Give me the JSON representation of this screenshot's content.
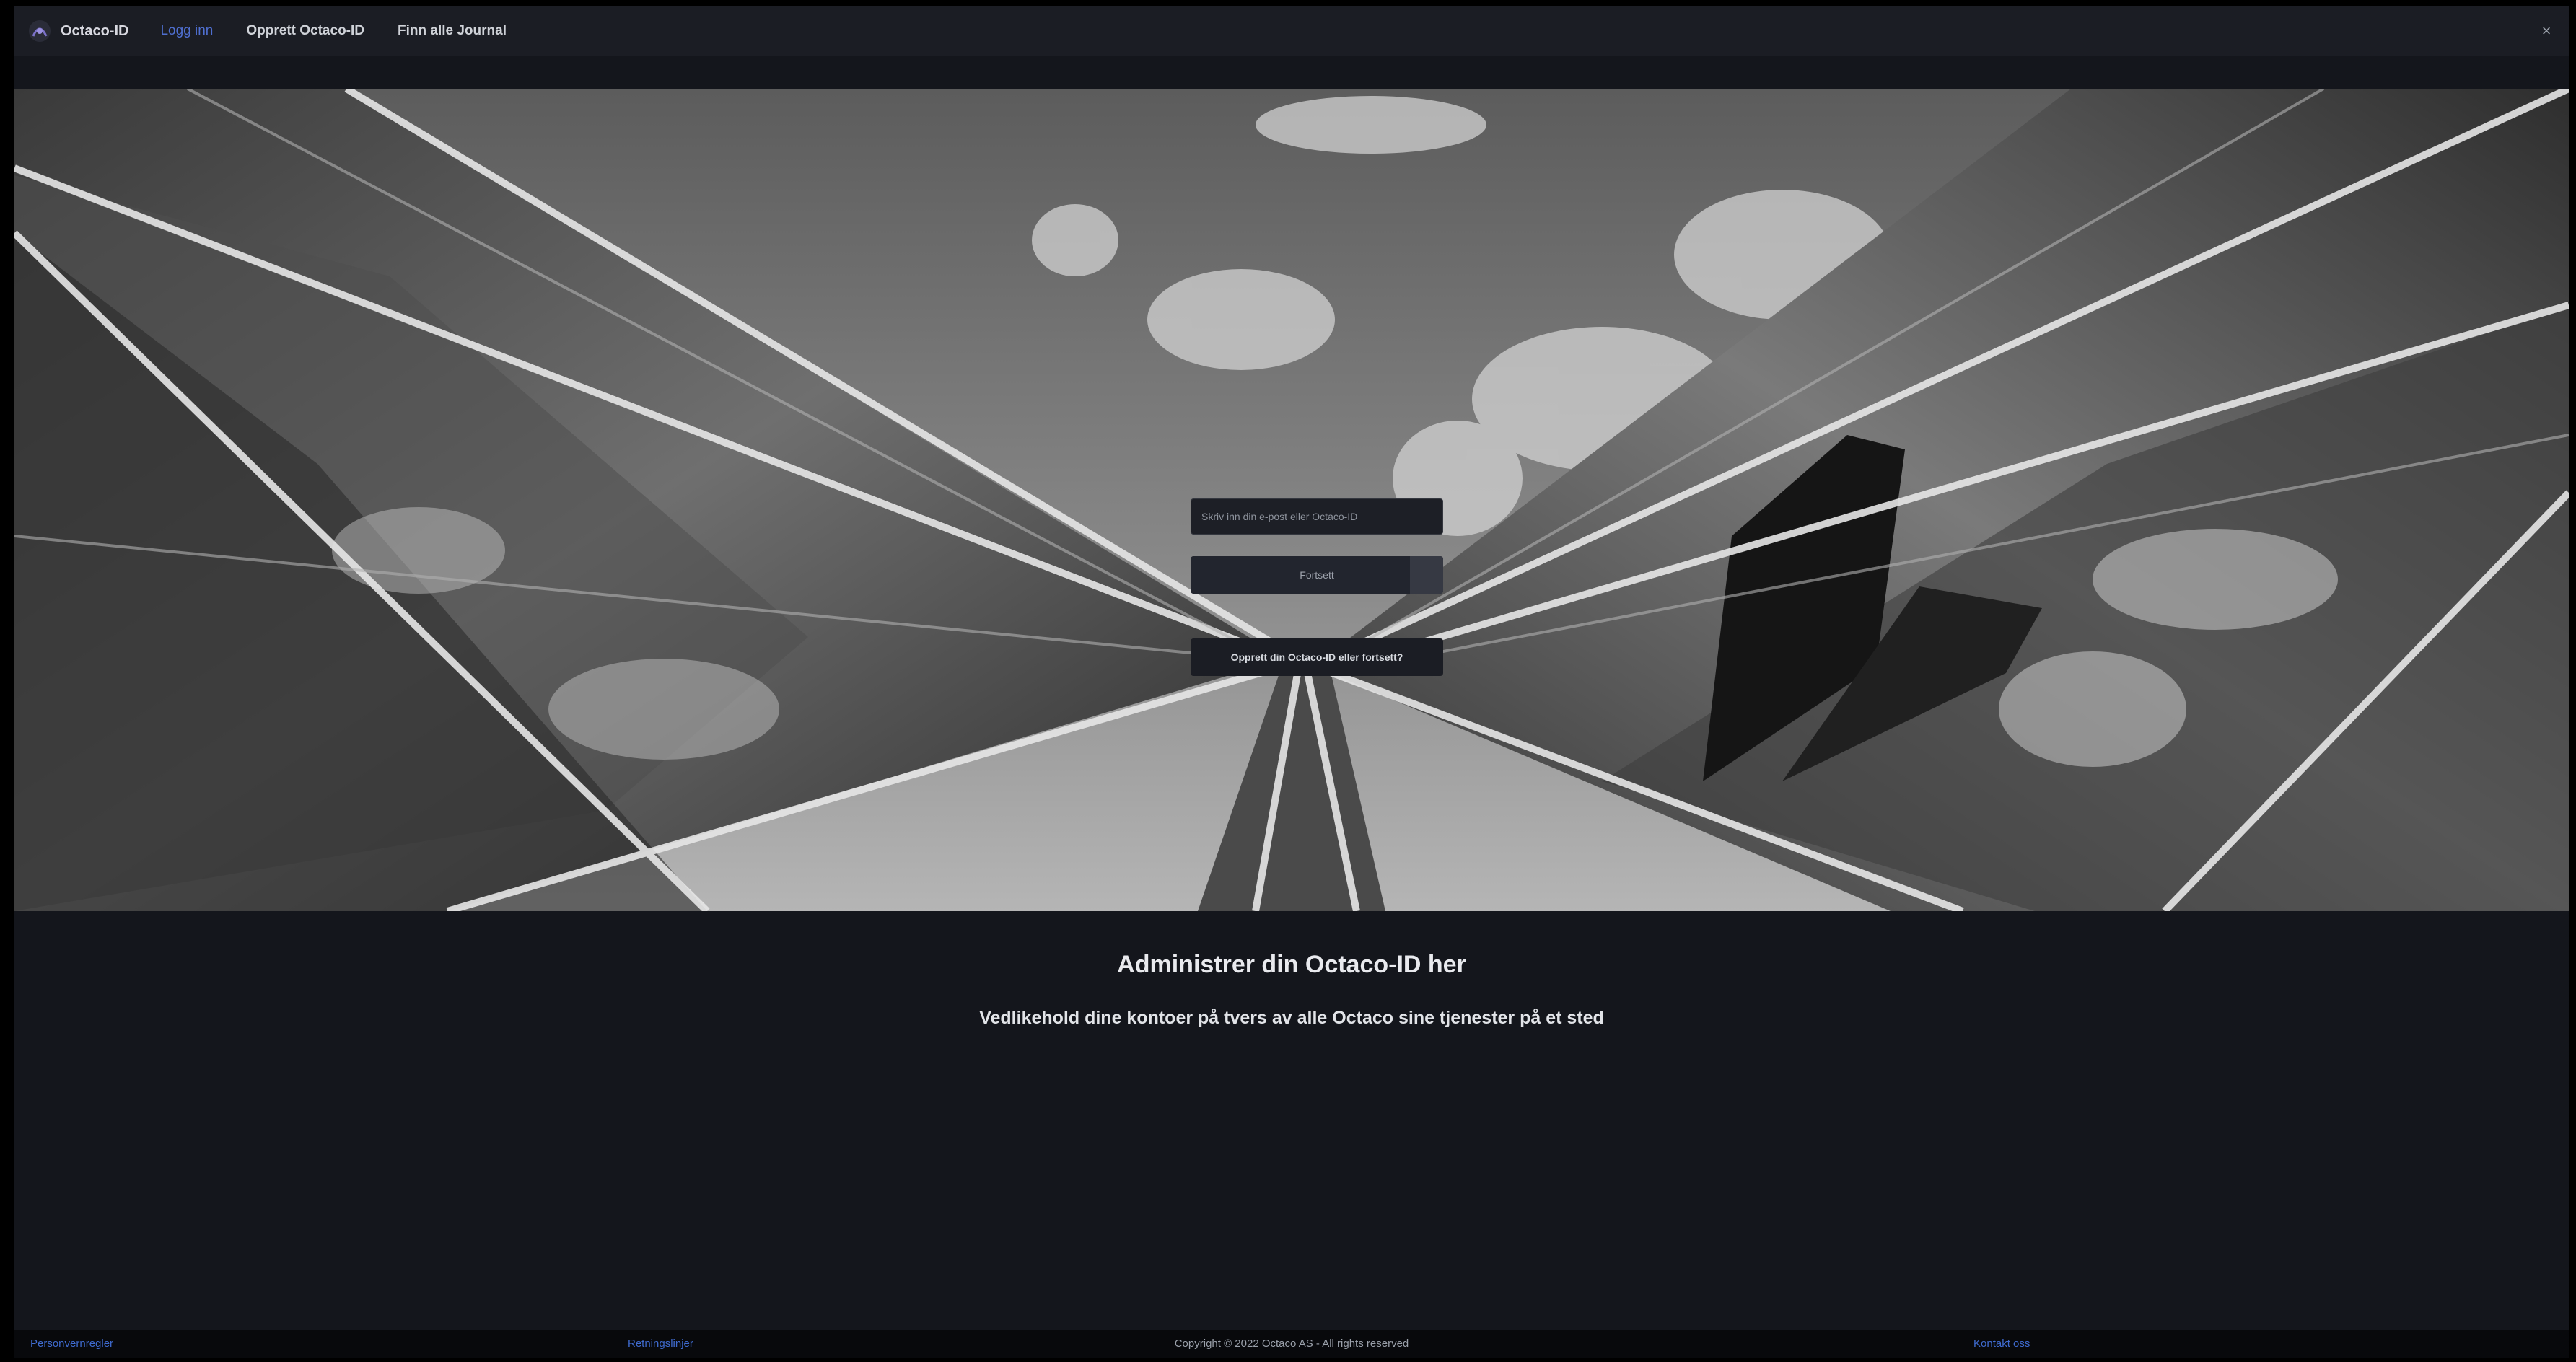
{
  "nav": {
    "brand": "Octaco-ID",
    "links": [
      {
        "label": "Logg inn",
        "active": true
      },
      {
        "label": "Opprett Octaco-ID"
      },
      {
        "label": "Finn alle Journal"
      }
    ],
    "close_icon": "close-icon"
  },
  "login": {
    "identity_placeholder": "Skriv inn din e-post eller Octaco-ID",
    "login_button": "Fortsett",
    "create_button": "Opprett din Octaco-ID eller fortsett?"
  },
  "info": {
    "title": "Administrer din Octaco-ID her",
    "subtitle": "Vedlikehold dine kontoer på tvers av alle Octaco sine tjenester på et sted"
  },
  "footer": {
    "left_link": "Personvernregler",
    "mid_link": "Retningslinjer",
    "copyright": "Copyright © 2022 Octaco AS - All rights reserved",
    "right_link": "Kontakt oss"
  },
  "colors": {
    "accent": "#4f6fd1",
    "background": "#14161c"
  }
}
